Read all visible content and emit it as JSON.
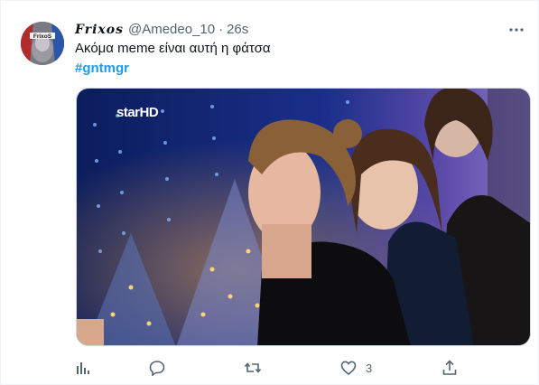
{
  "tweet": {
    "display_name": "Frixos",
    "avatar_label": "FrixoS",
    "handle": "@Amedeo_10",
    "separator": "·",
    "time": "26s",
    "text": "Ακόμα meme είναι αυτή η φάτσα",
    "hashtag": "#gntmgr"
  },
  "media": {
    "channel_logo": "starHD",
    "description_icon": "tv-still-image"
  },
  "actions": {
    "analytics": {
      "icon": "analytics-icon",
      "count": ""
    },
    "reply": {
      "icon": "reply-icon",
      "count": ""
    },
    "retweet": {
      "icon": "retweet-icon",
      "count": ""
    },
    "like": {
      "icon": "heart-icon",
      "count": "3"
    },
    "share": {
      "icon": "share-icon",
      "count": ""
    }
  },
  "colors": {
    "link": "#1d9bf0",
    "muted": "#536471",
    "text": "#0f1419"
  }
}
